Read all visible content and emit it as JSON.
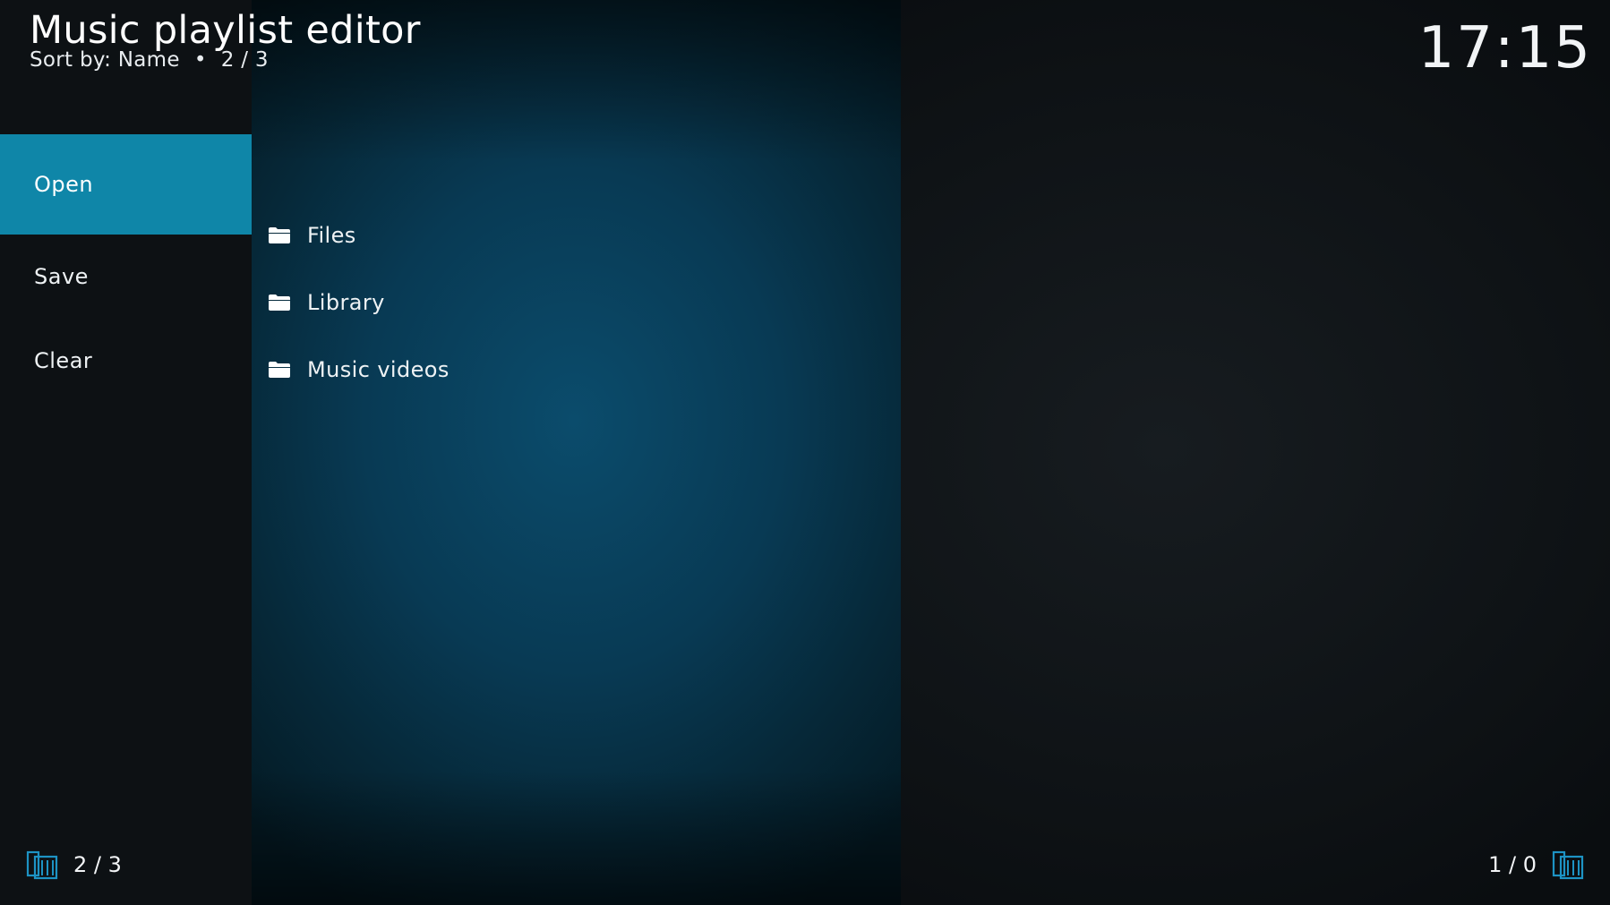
{
  "header": {
    "title": "Music playlist editor",
    "sort_label": "Sort by: Name",
    "separator": "•",
    "item_position": "2 / 3"
  },
  "clock": "17:15",
  "sidebar": {
    "items": [
      {
        "label": "Open",
        "active": true
      },
      {
        "label": "Save",
        "active": false
      },
      {
        "label": "Clear",
        "active": false
      }
    ]
  },
  "list": {
    "items": [
      {
        "label": "Files",
        "icon": "folder-icon"
      },
      {
        "label": "Library",
        "icon": "folder-icon"
      },
      {
        "label": "Music videos",
        "icon": "folder-icon"
      }
    ]
  },
  "footer": {
    "left_count": "2 / 3",
    "left_icon": "page-count-icon",
    "right_count": "1 / 0",
    "right_icon": "page-count-icon"
  },
  "colors": {
    "accent": "#0f86a8",
    "icon_accent": "#1d93c4"
  }
}
